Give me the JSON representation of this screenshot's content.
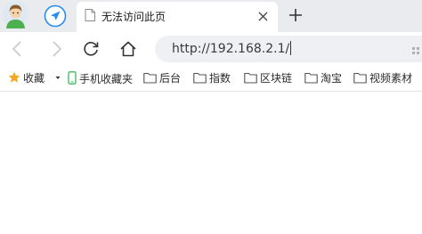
{
  "tab": {
    "title": "无法访问此页"
  },
  "address_bar": {
    "url": "http://192.168.2.1/"
  },
  "bookmarks": {
    "favorites_label": "收藏",
    "items": [
      {
        "label": "手机收藏夹",
        "icon": "phone-icon"
      },
      {
        "label": "后台",
        "icon": "folder-icon"
      },
      {
        "label": "指数",
        "icon": "folder-icon"
      },
      {
        "label": "区块链",
        "icon": "folder-icon"
      },
      {
        "label": "淘宝",
        "icon": "folder-icon"
      },
      {
        "label": "视频素材",
        "icon": "folder-icon"
      }
    ]
  },
  "colors": {
    "tabstrip": "#e9ebee",
    "address_bar": "#eff0f3",
    "star": "#f5a623",
    "phone": "#3dbb5b",
    "nav_blue": "#2a8cf0"
  }
}
